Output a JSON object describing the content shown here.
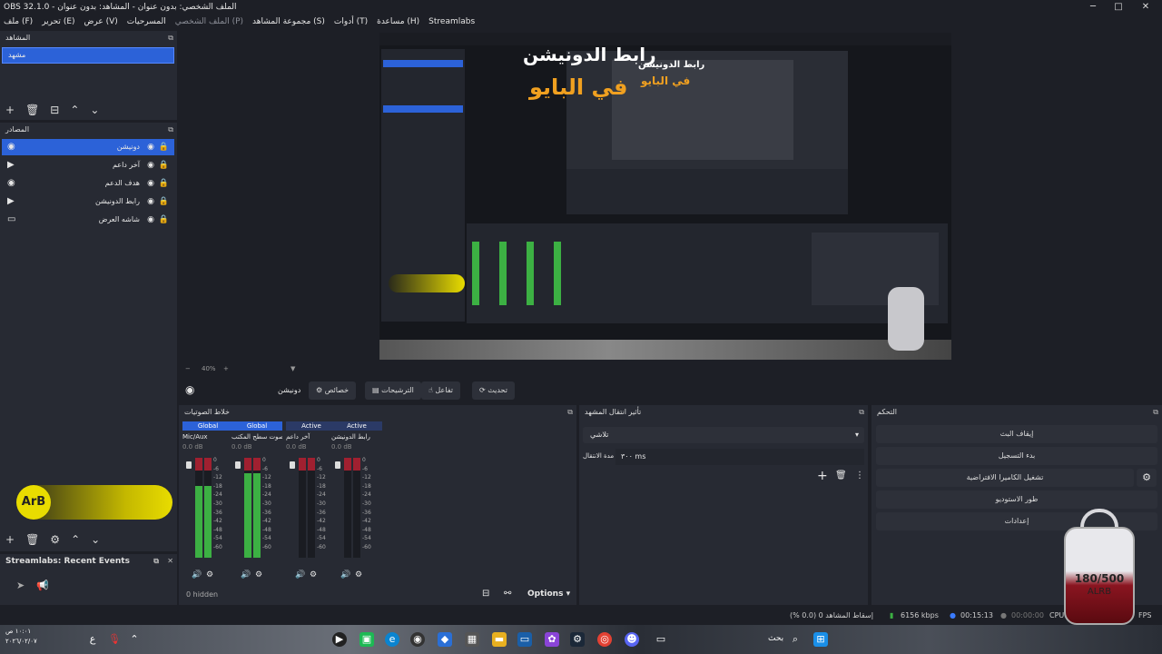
{
  "title": "OBS 32.1.0 - الملف الشخصي: بدون عنوان - المشاهد: بدون عنوان",
  "menu": [
    "ملف (F)",
    "تحرير (E)",
    "عرض (V)",
    "المسرحيات",
    "الملف الشخصي (P)",
    "مجموعة المشاهد (S)",
    "أدوات (T)",
    "مساعدة (H)",
    "Streamlabs"
  ],
  "scenes": {
    "header": "المشاهد",
    "selected": "مشهد"
  },
  "sources": {
    "header": "المصادر",
    "items": [
      {
        "name": "دونيشن",
        "icon": "globe"
      },
      {
        "name": "آخر داعم",
        "icon": "play"
      },
      {
        "name": "هدف الدعم",
        "icon": "globe"
      },
      {
        "name": "رابط الدونيشن",
        "icon": "play"
      },
      {
        "name": "شاشه العرض",
        "icon": "monitor"
      }
    ]
  },
  "preview": {
    "headline": "رابط الدونيشن",
    "subline": "في البايو",
    "mini_headline": "رابط الدونيشن",
    "mini_subline": "في البايو",
    "zoom": "40%"
  },
  "transition_bar": {
    "source_label": "دونيشن",
    "properties": "خصائص",
    "filters": "الترشيحات",
    "interact": "تفاعل",
    "refresh": "تحديث"
  },
  "mixer": {
    "header": "خلاط الصوتيات",
    "channels": [
      {
        "tag": "Global",
        "name": "Mic/Aux",
        "db": "0.0 dB",
        "level": 0.72,
        "tagcolor": "#2c62d8"
      },
      {
        "tag": "Global",
        "name": "صوت سطح المكتب",
        "db": "0.0 dB",
        "level": 0.85,
        "tagcolor": "#2c62d8"
      },
      {
        "tag": "Active",
        "name": "آخر داعم",
        "db": "0.0 dB",
        "level": 0.0,
        "tagcolor": "#2b3a66"
      },
      {
        "tag": "Active",
        "name": "رابط الدونيشن",
        "db": "0.0 dB",
        "level": 0.0,
        "tagcolor": "#2b3a66"
      }
    ],
    "scale": [
      "0",
      "-6",
      "-12",
      "-18",
      "-24",
      "-30",
      "-36",
      "-42",
      "-48",
      "-54",
      "-60"
    ],
    "hidden": "0 hidden",
    "options": "Options"
  },
  "transitions": {
    "header": "تأثير انتقال المشهد",
    "selected": "تلاشي",
    "duration_label": "مدة الانتقال",
    "duration_value": "٣٠٠ ms"
  },
  "controls": {
    "header": "التحكم",
    "buttons": [
      "إيقاف البث",
      "بدء التسجيل",
      "تشغيل الكاميرا الافتراضية",
      "طور الاستوديو",
      "إعدادات"
    ]
  },
  "arb": {
    "label": "ArB"
  },
  "events": {
    "header": "Streamlabs: Recent Events"
  },
  "status": {
    "dropped": "إسقاط المشاهد 0 (0.0 %)",
    "kbps": "6156 kbps",
    "live_time": "00:15:13",
    "rec_time": "00:00:00",
    "cpu": "CPU",
    "fps": "FPS"
  },
  "taskbar": {
    "search": "بحث",
    "time": "١٠:٠١ ص",
    "date": "٢٠٢٦/٠٢/٠٧"
  },
  "bag": {
    "count": "180/500",
    "label": "ALRB"
  }
}
